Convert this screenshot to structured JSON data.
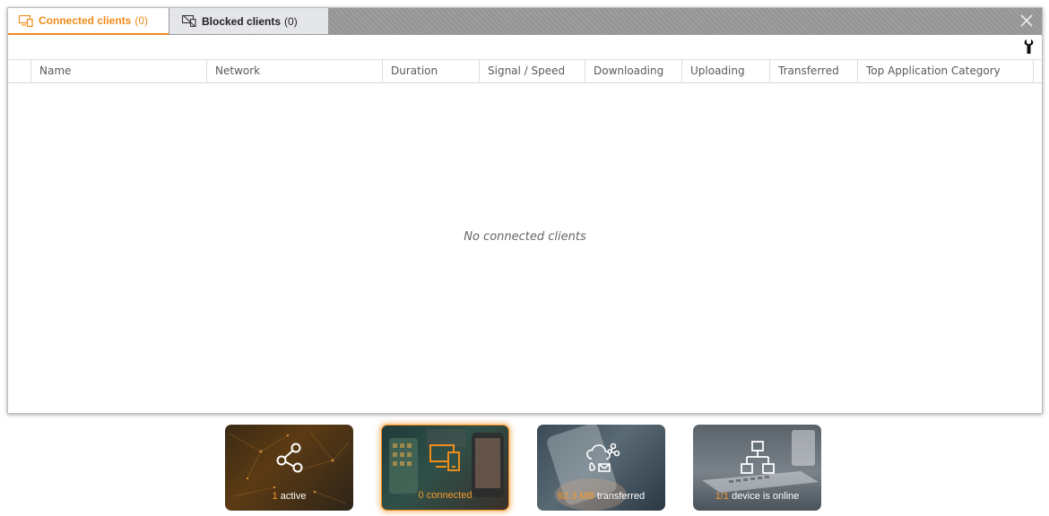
{
  "tabs": {
    "connected": {
      "label": "Connected clients",
      "count": "(0)"
    },
    "blocked": {
      "label": "Blocked clients",
      "count": "(0)"
    }
  },
  "toolbar": {
    "tools_icon": "wrench-icon"
  },
  "table": {
    "columns": [
      "Name",
      "Network",
      "Duration",
      "Signal / Speed",
      "Downloading",
      "Uploading",
      "Transferred",
      "Top Application Category"
    ],
    "empty_message": "No connected clients"
  },
  "cards": [
    {
      "number": "1",
      "text": "active",
      "icon": "network-nodes-icon"
    },
    {
      "number": "0",
      "text": "connected",
      "icon": "devices-icon"
    },
    {
      "number": "92.3 MB",
      "text": "transferred",
      "icon": "cloud-share-icon"
    },
    {
      "number": "1/1",
      "text": "device is online",
      "icon": "hierarchy-icon"
    }
  ],
  "colors": {
    "accent": "#f08c1a",
    "tabbar": "#9a9a9a"
  }
}
